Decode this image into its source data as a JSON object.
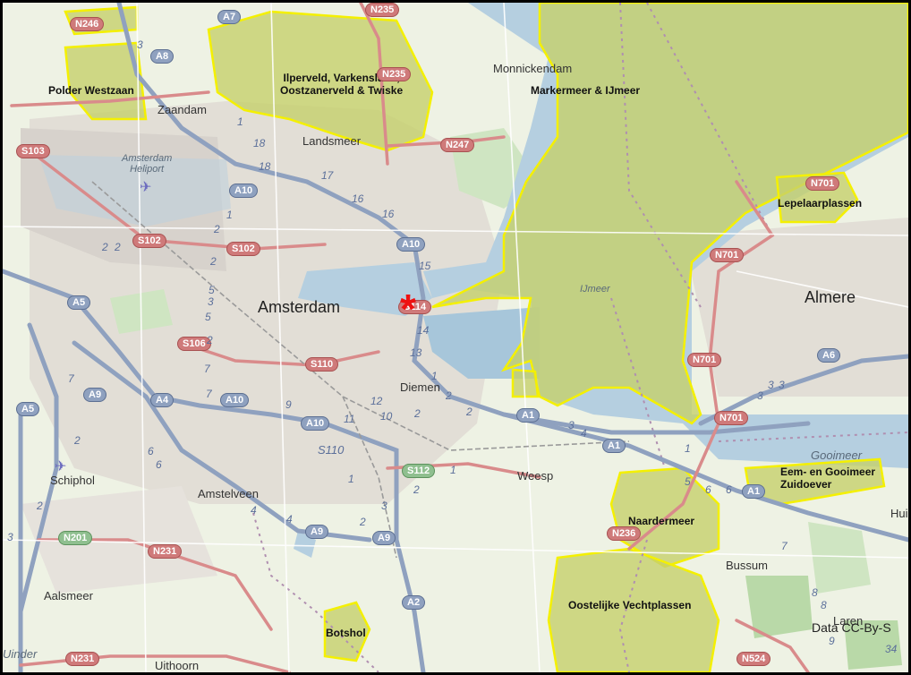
{
  "places": [
    {
      "id": "zaandam",
      "label": "Zaandam"
    },
    {
      "id": "landsmeer",
      "label": "Landsmeer"
    },
    {
      "id": "monnickendam",
      "label": "Monnickendam"
    },
    {
      "id": "heliport",
      "label": "Amsterdam\nHeliport"
    },
    {
      "id": "amsterdam",
      "label": "Amsterdam"
    },
    {
      "id": "diemen",
      "label": "Diemen"
    },
    {
      "id": "almere",
      "label": "Almere"
    },
    {
      "id": "weesp",
      "label": "Weesp"
    },
    {
      "id": "schiphol",
      "label": "Schiphol"
    },
    {
      "id": "amstelveen",
      "label": "Amstelveen"
    },
    {
      "id": "bussum",
      "label": "Bussum"
    },
    {
      "id": "aalsmeer",
      "label": "Aalsmeer"
    },
    {
      "id": "uithoorn",
      "label": "Uithoorn"
    },
    {
      "id": "huizen",
      "label": "Hui"
    },
    {
      "id": "laren",
      "label": "Laren"
    },
    {
      "id": "uithoorn-edge",
      "label": "Uinder"
    }
  ],
  "areas": [
    {
      "id": "polder-westzaan",
      "label": "Polder Westzaan"
    },
    {
      "id": "ilperveld",
      "label": "Ilperveld, Varkensland,\nOostzanerveld & Twiske"
    },
    {
      "id": "markermeer",
      "label": "Markermeer & IJmeer"
    },
    {
      "id": "lepelaarplassen",
      "label": "Lepelaarplassen"
    },
    {
      "id": "eem-gooimeer",
      "label": "Eem- en Gooimeer\nZuidoever"
    },
    {
      "id": "naardermeer",
      "label": "Naardermeer"
    },
    {
      "id": "oostelijke-vechtplassen",
      "label": "Oostelijke Vechtplassen"
    },
    {
      "id": "botshol",
      "label": "Botshol"
    }
  ],
  "water_labels": [
    {
      "id": "ijmeer",
      "label": "IJmeer"
    },
    {
      "id": "gooimeer",
      "label": "Gooimeer"
    }
  ],
  "shields": [
    {
      "id": "n246",
      "label": "N246",
      "kind": "n"
    },
    {
      "id": "a7",
      "label": "A7",
      "kind": "a"
    },
    {
      "id": "n235-top",
      "label": "N235",
      "kind": "n"
    },
    {
      "id": "a8",
      "label": "A8",
      "kind": "a"
    },
    {
      "id": "n235",
      "label": "N235",
      "kind": "n"
    },
    {
      "id": "n247",
      "label": "N247",
      "kind": "n"
    },
    {
      "id": "s103",
      "label": "S103",
      "kind": "s"
    },
    {
      "id": "a10-n",
      "label": "A10",
      "kind": "a"
    },
    {
      "id": "s102-a",
      "label": "S102",
      "kind": "s"
    },
    {
      "id": "s102-b",
      "label": "S102",
      "kind": "s"
    },
    {
      "id": "a10-e",
      "label": "A10",
      "kind": "a"
    },
    {
      "id": "a5-n",
      "label": "A5",
      "kind": "a"
    },
    {
      "id": "s114",
      "label": "S114",
      "kind": "s"
    },
    {
      "id": "s106",
      "label": "S106",
      "kind": "s"
    },
    {
      "id": "s110",
      "label": "S110",
      "kind": "s"
    },
    {
      "id": "a9-n",
      "label": "A9",
      "kind": "a"
    },
    {
      "id": "a4",
      "label": "A4",
      "kind": "a"
    },
    {
      "id": "a10-s",
      "label": "A10",
      "kind": "a"
    },
    {
      "id": "a5-s",
      "label": "A5",
      "kind": "a"
    },
    {
      "id": "a10-se",
      "label": "A10",
      "kind": "a"
    },
    {
      "id": "a1-w",
      "label": "A1",
      "kind": "a"
    },
    {
      "id": "a1-e",
      "label": "A1",
      "kind": "a"
    },
    {
      "id": "s112",
      "label": "S112",
      "kind": "green"
    },
    {
      "id": "n701-a",
      "label": "N701",
      "kind": "n"
    },
    {
      "id": "n701-b",
      "label": "N701",
      "kind": "n"
    },
    {
      "id": "n701-c",
      "label": "N701",
      "kind": "n"
    },
    {
      "id": "n701-d",
      "label": "N701",
      "kind": "n"
    },
    {
      "id": "a6",
      "label": "A6",
      "kind": "a"
    },
    {
      "id": "a1-far",
      "label": "A1",
      "kind": "a"
    },
    {
      "id": "n236",
      "label": "N236",
      "kind": "n"
    },
    {
      "id": "n201",
      "label": "N201",
      "kind": "green"
    },
    {
      "id": "n231-a",
      "label": "N231",
      "kind": "n"
    },
    {
      "id": "a9-s",
      "label": "A9",
      "kind": "a"
    },
    {
      "id": "a9-s2",
      "label": "A9",
      "kind": "a"
    },
    {
      "id": "a2",
      "label": "A2",
      "kind": "a"
    },
    {
      "id": "n231-b",
      "label": "N231",
      "kind": "n"
    },
    {
      "id": "n524",
      "label": "N524",
      "kind": "n"
    }
  ],
  "numbers": [
    "3",
    "1",
    "18",
    "18",
    "17",
    "16",
    "16",
    "15",
    "14",
    "13",
    "12",
    "11",
    "9",
    "7",
    "7",
    "6",
    "6",
    "5",
    "5",
    "4",
    "4",
    "3",
    "3",
    "2",
    "2",
    "2",
    "2",
    "2",
    "1",
    "1",
    "5",
    "6",
    "6",
    "7",
    "8",
    "8",
    "9",
    "34",
    "2",
    "3",
    "4",
    "1",
    "2",
    "3",
    "2",
    "1",
    "2",
    "2",
    "7",
    "10",
    "3",
    "1",
    "2",
    "3",
    "3",
    "2"
  ],
  "road_labels": [
    {
      "id": "s110-road",
      "label": "S110"
    }
  ],
  "marker": {
    "label": "*",
    "color": "#e11111"
  },
  "attribution": "Data CC-By-S",
  "colors": {
    "land": "#eef2e4",
    "water": "#b5cfe0",
    "protected_fill": "#c5cf6c",
    "protected_outline": "#f4f000",
    "urban": "#dedad3",
    "motorway": "#8fa1bf",
    "primary": "#d98b8b"
  }
}
